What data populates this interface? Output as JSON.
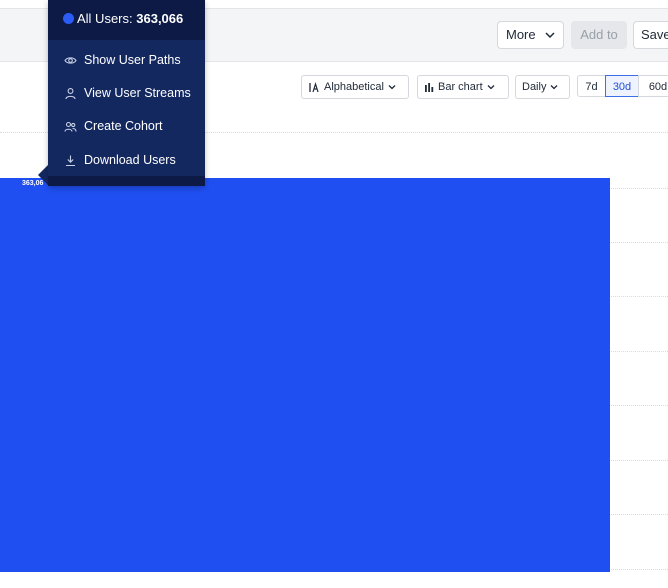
{
  "toolbar": {
    "more_label": "More",
    "add_to_label": "Add to",
    "save_label": "Save"
  },
  "controls": {
    "sort_label": "Alphabetical",
    "chart_type_label": "Bar chart",
    "interval_label": "Daily",
    "ranges": [
      "7d",
      "30d",
      "60d"
    ],
    "selected_range": "30d"
  },
  "popup": {
    "segment_name": "All Users:",
    "segment_value": "363,066",
    "items": [
      {
        "label": "Show User Paths",
        "icon": "eye-icon"
      },
      {
        "label": "View User Streams",
        "icon": "user-icon"
      },
      {
        "label": "Create Cohort",
        "icon": "users-icon"
      },
      {
        "label": "Download Users",
        "icon": "download-icon"
      }
    ]
  },
  "colors": {
    "bar": "#1f4ff0",
    "popup_bg": "#142860",
    "popup_header": "#0c1a45",
    "accent": "#1f4fd6"
  },
  "chart_data": {
    "type": "bar",
    "categories": [
      ""
    ],
    "series": [
      {
        "values": [
          363066
        ]
      }
    ],
    "data_labels": [
      "363,06"
    ]
  }
}
